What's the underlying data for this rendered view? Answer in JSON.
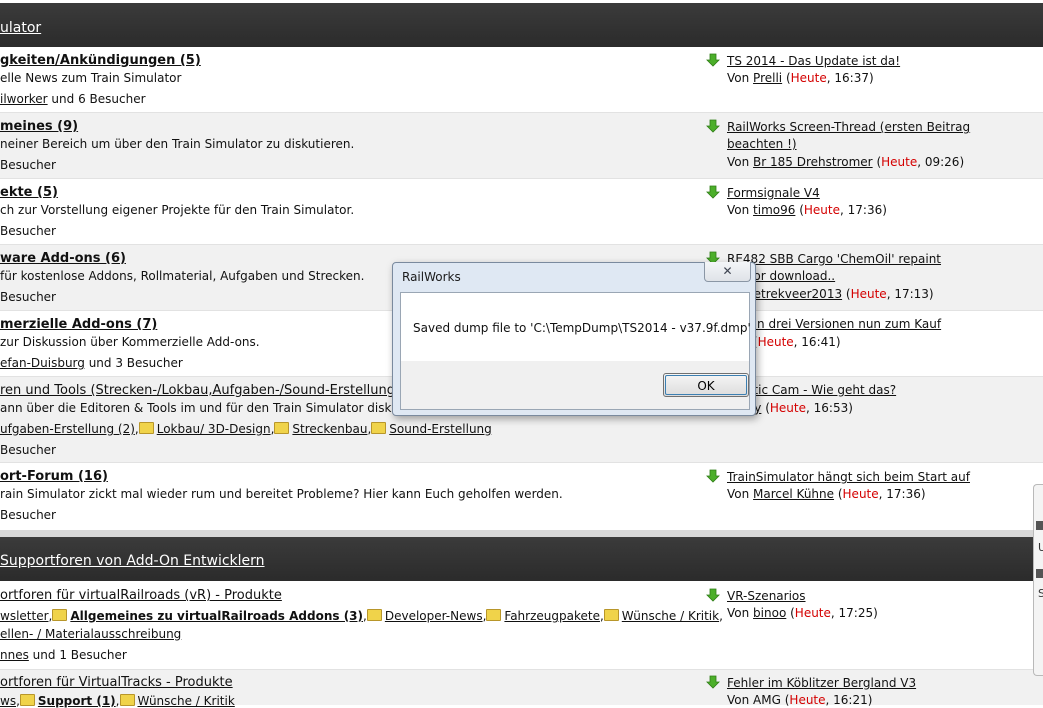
{
  "categories": [
    {
      "title": "ulator"
    },
    {
      "title": "Supportforen von Add-On Entwicklern"
    }
  ],
  "forums": [
    {
      "title": "gkeiten/Ankündigungen (5)",
      "desc": "elle News zum Train Simulator",
      "online_user": "ilworker",
      "online_rest": " und 6 Besucher",
      "last_title": "TS 2014 - Das Update ist da!",
      "last_by": "Prelli",
      "last_when": "Heute",
      "last_time": ", 16:37)"
    },
    {
      "title": "meines (9)",
      "desc": "neiner Bereich um über den Train Simulator zu diskutieren.",
      "online_text": "Besucher",
      "last_title": "RailWorks Screen-Thread (ersten Beitrag",
      "last_title2": "beachten !)",
      "last_by": "Br 185 Drehstromer",
      "last_when": "Heute",
      "last_time": ", 09:26)"
    },
    {
      "title": "ekte (5)",
      "desc": "ch zur Vorstellung eigener Projekte für den Train Simulator.",
      "online_text": "Besucher",
      "last_title": "Formsignale V4",
      "last_by": "timo96",
      "last_when": "Heute",
      "last_time": ", 17:36)"
    },
    {
      "title": "ware Add-ons (6)",
      "desc": " für kostenlose Addons, Rollmaterial, Aufgaben und Strecken.",
      "online_text": "Besucher",
      "last_title": "RE482 SBB Cargo 'ChemOil' repaint",
      "last_title2": "ble for download..",
      "last_by": "Duwetrekveer2013",
      "last_when": "Heute",
      "last_time": ", 17:13)"
    },
    {
      "title": "merzielle Add-ons (7)",
      "desc": " zur Diskussion über Kommerzielle Add-ons.",
      "online_user": "efan-Duisburg",
      "online_rest": " und 3 Besucher",
      "last_title": "103 in drei Versionen nun zum Kauf",
      "last_by": "relli",
      "last_when": "Heute",
      "last_time": ", 16:41)"
    },
    {
      "title": "ren und Tools (Strecken-/Lokbau,Aufgaben-/Sound-Erstellung",
      "desc": "ann über die Editoren & Tools im und für den Train Simulator diskutie",
      "subforums": [
        "ufgaben-Erstellung (2)",
        "Lokbau/ 3D-Design",
        "Streckenbau",
        "Sound-Erstellung"
      ],
      "online_text": "Besucher",
      "last_title": "ematic Cam - Wie geht das?",
      "last_by": "reddy",
      "last_when": "Heute",
      "last_time": ", 16:53)"
    },
    {
      "title": "ort-Forum (16)",
      "desc": "rain Simulator zickt mal wieder rum und bereitet Probleme? Hier kann Euch geholfen werden.",
      "online_text": "Besucher",
      "last_title": "TrainSimulator hängt sich beim Start auf",
      "last_by": "Marcel Kühne",
      "last_when": "Heute",
      "last_time": ", 17:36)"
    },
    {
      "title": "ortforen für virtualRailroads (vR) - Produkte",
      "subforums_a": [
        "wsletter",
        "Allgemeines zu virtualRailroads Addons (3)",
        "Developer-News",
        "Fahrzeugpakete",
        "Wünsche / Kritik"
      ],
      "subforums_b": "ellen- / Materialausschreibung",
      "online_user": "nnes",
      "online_rest": " und 1 Besucher",
      "last_title": "VR-Szenarios",
      "last_by": "binoo",
      "last_when": "Heute",
      "last_time": ", 17:25)"
    },
    {
      "title": "ortforen für VirtualTracks - Produkte",
      "subforums_a": [
        "ws",
        "Support (1)",
        "Wünsche / Kritik"
      ],
      "last_title": "Fehler im Köblitzer Bergland V3",
      "last_by_plain": "AMG",
      "last_when": "Heute",
      "last_time": ", 16:21)"
    }
  ],
  "common": {
    "von": "Von ",
    "open_paren": " (",
    "comma": ",",
    "edge_chars": [
      "U",
      "S"
    ]
  },
  "dialog": {
    "title": "RailWorks",
    "close_glyph": "✕",
    "message": "Saved dump file to 'C:\\TempDump\\TS2014 - v37.9f.dmp'",
    "ok_label": "OK"
  }
}
